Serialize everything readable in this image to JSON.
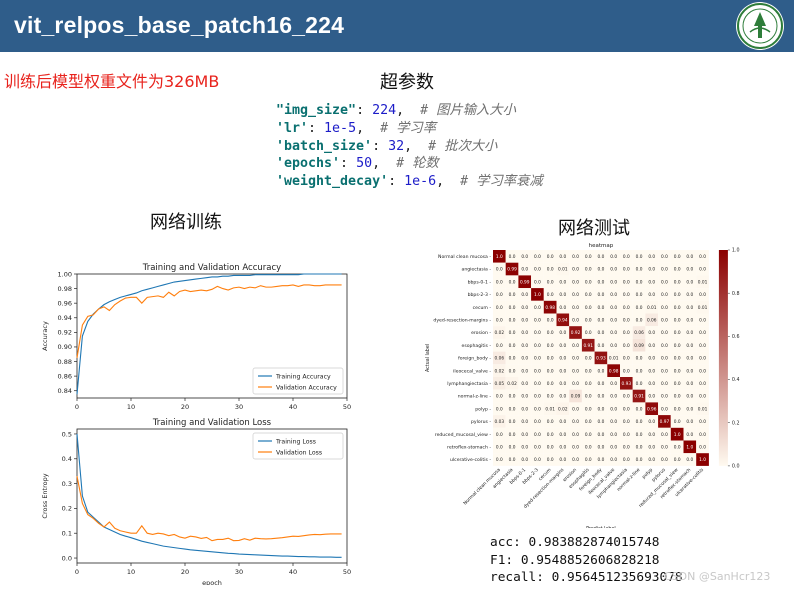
{
  "header": {
    "title": "vit_relpos_base_patch16_224"
  },
  "note": "训练后模型权重文件为326MB",
  "hyper": {
    "title": "超参数",
    "lines": [
      {
        "key": "'img_size'",
        "sep": ": ",
        "val": "224",
        "comment": "# 图片输入大小",
        "keyq": "\"img_size\""
      },
      {
        "key": "'lr'",
        "sep": ": ",
        "val": "1e-5",
        "comment": "# 学习率"
      },
      {
        "key": "'batch_size'",
        "sep": ": ",
        "val": "32",
        "comment": "# 批次大小"
      },
      {
        "key": "'epochs'",
        "sep": ": ",
        "val": "50",
        "comment": "# 轮数"
      },
      {
        "key": "'weight_decay'",
        "sep": ": ",
        "val": "1e-6",
        "comment": "# 学习率衰减"
      }
    ]
  },
  "train_title": "网络训练",
  "test_title": "网络测试",
  "metrics": {
    "acc": "acc: 0.983882874015748",
    "f1": "F1: 0.9548852606828218",
    "recall": "recall: 0.956451235693078"
  },
  "watermark": "CSDN @SanHcr123",
  "colors": {
    "train": "#1f77b4",
    "val": "#ff7f0e",
    "header": "#2f5d8a"
  },
  "chart_data": [
    {
      "type": "line",
      "title": "Training and Validation Accuracy",
      "xlabel": "",
      "ylabel": "Accuracy",
      "xlim": [
        0,
        50
      ],
      "ylim": [
        0.83,
        1.0
      ],
      "xticks": [
        0,
        10,
        20,
        30,
        40,
        50
      ],
      "yticks": [
        0.84,
        0.86,
        0.88,
        0.9,
        0.92,
        0.94,
        0.96,
        0.98,
        1.0
      ],
      "legend": "lower-right",
      "x": [
        0,
        1,
        2,
        3,
        4,
        5,
        6,
        7,
        8,
        9,
        10,
        11,
        12,
        13,
        14,
        15,
        16,
        17,
        18,
        19,
        20,
        21,
        22,
        23,
        24,
        25,
        26,
        27,
        28,
        29,
        30,
        31,
        32,
        33,
        34,
        35,
        36,
        37,
        38,
        39,
        40,
        41,
        42,
        43,
        44,
        45,
        46,
        47,
        48,
        49
      ],
      "series": [
        {
          "name": "Training Accuracy",
          "values": [
            0.835,
            0.915,
            0.935,
            0.945,
            0.952,
            0.958,
            0.962,
            0.965,
            0.968,
            0.97,
            0.972,
            0.974,
            0.977,
            0.979,
            0.981,
            0.983,
            0.985,
            0.987,
            0.989,
            0.99,
            0.991,
            0.992,
            0.993,
            0.994,
            0.995,
            0.996,
            0.996,
            0.997,
            0.997,
            0.998,
            0.998,
            0.998,
            0.998,
            0.999,
            0.999,
            0.999,
            0.999,
            0.999,
            0.999,
            0.999,
            0.999,
            0.999,
            1.0,
            1.0,
            1.0,
            1.0,
            1.0,
            1.0,
            1.0,
            1.0
          ]
        },
        {
          "name": "Validation Accuracy",
          "values": [
            0.885,
            0.93,
            0.942,
            0.944,
            0.952,
            0.955,
            0.95,
            0.958,
            0.963,
            0.967,
            0.968,
            0.968,
            0.96,
            0.968,
            0.969,
            0.97,
            0.968,
            0.975,
            0.97,
            0.976,
            0.978,
            0.976,
            0.977,
            0.978,
            0.977,
            0.979,
            0.983,
            0.98,
            0.978,
            0.981,
            0.982,
            0.98,
            0.982,
            0.981,
            0.984,
            0.982,
            0.982,
            0.983,
            0.984,
            0.984,
            0.985,
            0.983,
            0.985,
            0.985,
            0.984,
            0.984,
            0.985,
            0.985,
            0.985,
            0.985
          ]
        }
      ]
    },
    {
      "type": "line",
      "title": "Training and Validation Loss",
      "xlabel": "epoch",
      "ylabel": "Cross Entropy",
      "xlim": [
        0,
        50
      ],
      "ylim": [
        -0.02,
        0.52
      ],
      "xticks": [
        0,
        10,
        20,
        30,
        40,
        50
      ],
      "yticks": [
        0.0,
        0.1,
        0.2,
        0.3,
        0.4,
        0.5
      ],
      "legend": "upper-right",
      "x": [
        0,
        1,
        2,
        3,
        4,
        5,
        6,
        7,
        8,
        9,
        10,
        11,
        12,
        13,
        14,
        15,
        16,
        17,
        18,
        19,
        20,
        21,
        22,
        23,
        24,
        25,
        26,
        27,
        28,
        29,
        30,
        31,
        32,
        33,
        34,
        35,
        36,
        37,
        38,
        39,
        40,
        41,
        42,
        43,
        44,
        45,
        46,
        47,
        48,
        49
      ],
      "series": [
        {
          "name": "Training Loss",
          "values": [
            0.5,
            0.25,
            0.185,
            0.165,
            0.145,
            0.125,
            0.115,
            0.105,
            0.095,
            0.088,
            0.082,
            0.075,
            0.068,
            0.063,
            0.058,
            0.053,
            0.048,
            0.045,
            0.042,
            0.039,
            0.036,
            0.033,
            0.031,
            0.029,
            0.027,
            0.025,
            0.023,
            0.021,
            0.019,
            0.018,
            0.016,
            0.015,
            0.014,
            0.013,
            0.012,
            0.011,
            0.01,
            0.009,
            0.008,
            0.008,
            0.007,
            0.006,
            0.006,
            0.005,
            0.005,
            0.004,
            0.004,
            0.004,
            0.003,
            0.003
          ]
        },
        {
          "name": "Validation Loss",
          "values": [
            0.33,
            0.22,
            0.175,
            0.16,
            0.14,
            0.125,
            0.145,
            0.12,
            0.11,
            0.105,
            0.1,
            0.1,
            0.13,
            0.1,
            0.095,
            0.1,
            0.097,
            0.09,
            0.095,
            0.085,
            0.08,
            0.088,
            0.085,
            0.079,
            0.083,
            0.07,
            0.075,
            0.075,
            0.08,
            0.07,
            0.071,
            0.078,
            0.072,
            0.08,
            0.078,
            0.077,
            0.078,
            0.08,
            0.082,
            0.085,
            0.088,
            0.087,
            0.09,
            0.093,
            0.095,
            0.094,
            0.096,
            0.097,
            0.097,
            0.097
          ]
        }
      ]
    },
    {
      "type": "heatmap",
      "title": "heatmap",
      "xlabel": "Predict label",
      "ylabel": "Actual label",
      "colorbar": [
        0,
        1
      ],
      "colorbar_ticks": [
        "0.0",
        "0.2",
        "0.4",
        "0.6",
        "0.8",
        "1.0"
      ],
      "labels": [
        "Normal clean mucosa",
        "angiectasia",
        "bbps-0-1",
        "bbps-2-3",
        "cecum",
        "dyed-resection-margins",
        "erosion",
        "esophagitis",
        "foreign_body",
        "ileocecal_valve",
        "lymphangiectasia",
        "normal-z-line",
        "polyp",
        "pylorus",
        "reduced_mucosal_view",
        "retroflex-stomach",
        "ulcerative-colitis"
      ],
      "matrix": [
        [
          1.0,
          0.0,
          0.0,
          0.0,
          0.0,
          0.0,
          0.0,
          0.0,
          0.0,
          0.0,
          0.0,
          0.0,
          0.0,
          0.0,
          0.0,
          0.0,
          0.0
        ],
        [
          0.0,
          0.99,
          0.0,
          0.0,
          0.0,
          0.01,
          0.0,
          0.0,
          0.0,
          0.0,
          0.0,
          0.0,
          0.0,
          0.0,
          0.0,
          0.0,
          0.0
        ],
        [
          0.0,
          0.0,
          0.99,
          0.0,
          0.0,
          0.0,
          0.0,
          0.0,
          0.0,
          0.0,
          0.0,
          0.0,
          0.0,
          0.0,
          0.0,
          0.0,
          0.01
        ],
        [
          0.0,
          0.0,
          0.0,
          1.0,
          0.0,
          0.0,
          0.0,
          0.0,
          0.0,
          0.0,
          0.0,
          0.0,
          0.0,
          0.0,
          0.0,
          0.0,
          0.0
        ],
        [
          0.0,
          0.0,
          0.0,
          0.0,
          0.98,
          0.0,
          0.0,
          0.0,
          0.0,
          0.0,
          0.0,
          0.0,
          0.01,
          0.0,
          0.0,
          0.0,
          0.01
        ],
        [
          0.0,
          0.0,
          0.0,
          0.0,
          0.0,
          0.94,
          0.0,
          0.0,
          0.0,
          0.0,
          0.0,
          0.0,
          0.06,
          0.0,
          0.0,
          0.0,
          0.0
        ],
        [
          0.02,
          0.0,
          0.0,
          0.0,
          0.0,
          0.0,
          0.92,
          0.0,
          0.0,
          0.0,
          0.0,
          0.06,
          0.0,
          0.0,
          0.0,
          0.0,
          0.0
        ],
        [
          0.0,
          0.0,
          0.0,
          0.0,
          0.0,
          0.0,
          0.0,
          0.91,
          0.0,
          0.0,
          0.0,
          0.09,
          0.0,
          0.0,
          0.0,
          0.0,
          0.0
        ],
        [
          0.06,
          0.0,
          0.0,
          0.0,
          0.0,
          0.0,
          0.0,
          0.0,
          0.93,
          0.01,
          0.0,
          0.0,
          0.0,
          0.0,
          0.0,
          0.0,
          0.0
        ],
        [
          0.02,
          0.0,
          0.0,
          0.0,
          0.0,
          0.0,
          0.0,
          0.0,
          0.0,
          0.98,
          0.0,
          0.0,
          0.0,
          0.0,
          0.0,
          0.0,
          0.0
        ],
        [
          0.05,
          0.02,
          0.0,
          0.0,
          0.0,
          0.0,
          0.0,
          0.0,
          0.0,
          0.0,
          0.93,
          0.0,
          0.0,
          0.0,
          0.0,
          0.0,
          0.0
        ],
        [
          0.0,
          0.0,
          0.0,
          0.0,
          0.0,
          0.0,
          0.09,
          0.0,
          0.0,
          0.0,
          0.0,
          0.91,
          0.0,
          0.0,
          0.0,
          0.0,
          0.0
        ],
        [
          0.0,
          0.0,
          0.0,
          0.0,
          0.01,
          0.02,
          0.0,
          0.0,
          0.0,
          0.0,
          0.0,
          0.0,
          0.96,
          0.0,
          0.0,
          0.0,
          0.01
        ],
        [
          0.03,
          0.0,
          0.0,
          0.0,
          0.0,
          0.0,
          0.0,
          0.0,
          0.0,
          0.0,
          0.0,
          0.0,
          0.0,
          0.97,
          0.0,
          0.0,
          0.0
        ],
        [
          0.0,
          0.0,
          0.0,
          0.0,
          0.0,
          0.0,
          0.0,
          0.0,
          0.0,
          0.0,
          0.0,
          0.0,
          0.0,
          0.0,
          1.0,
          0.0,
          0.0
        ],
        [
          0.0,
          0.0,
          0.0,
          0.0,
          0.0,
          0.0,
          0.0,
          0.0,
          0.0,
          0.0,
          0.0,
          0.0,
          0.0,
          0.0,
          0.0,
          1.0,
          0.0
        ],
        [
          0.0,
          0.0,
          0.0,
          0.0,
          0.0,
          0.0,
          0.0,
          0.0,
          0.0,
          0.0,
          0.0,
          0.0,
          0.0,
          0.0,
          0.0,
          0.0,
          1.0
        ]
      ]
    }
  ]
}
